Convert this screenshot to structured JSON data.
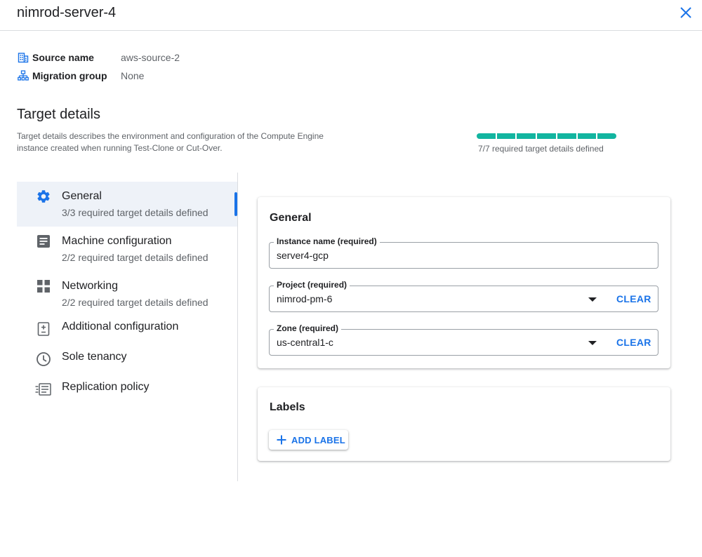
{
  "header": {
    "title": "nimrod-server-4"
  },
  "meta": {
    "source_label": "Source name",
    "source_value": "aws-source-2",
    "group_label": "Migration group",
    "group_value": "None"
  },
  "target": {
    "title": "Target details",
    "description": "Target details describes the environment and configuration of the Compute Engine instance created when running Test-Clone or Cut-Over.",
    "progress": {
      "completed": 7,
      "total": 7,
      "label": "7/7 required target details defined"
    },
    "accent_color": "#12b5a0"
  },
  "nav": {
    "items": [
      {
        "title": "General",
        "subtitle": "3/3 required target details defined",
        "icon": "gear-icon"
      },
      {
        "title": "Machine configuration",
        "subtitle": "2/2 required target details defined",
        "icon": "document-icon"
      },
      {
        "title": "Networking",
        "subtitle": "2/2 required target details defined",
        "icon": "grid-icon"
      },
      {
        "title": "Additional configuration",
        "icon": "plus-minus-icon"
      },
      {
        "title": "Sole tenancy",
        "icon": "clock-icon"
      },
      {
        "title": "Replication policy",
        "icon": "policy-list-icon"
      }
    ],
    "active_index": 0
  },
  "general_card": {
    "title": "General",
    "instance": {
      "label": "Instance name (required)",
      "value": "server4-gcp"
    },
    "project": {
      "label": "Project (required)",
      "value": "nimrod-pm-6",
      "clear": "CLEAR"
    },
    "zone": {
      "label": "Zone (required)",
      "value": "us-central1-c",
      "clear": "CLEAR"
    }
  },
  "labels_card": {
    "title": "Labels",
    "add_label": "ADD LABEL"
  }
}
